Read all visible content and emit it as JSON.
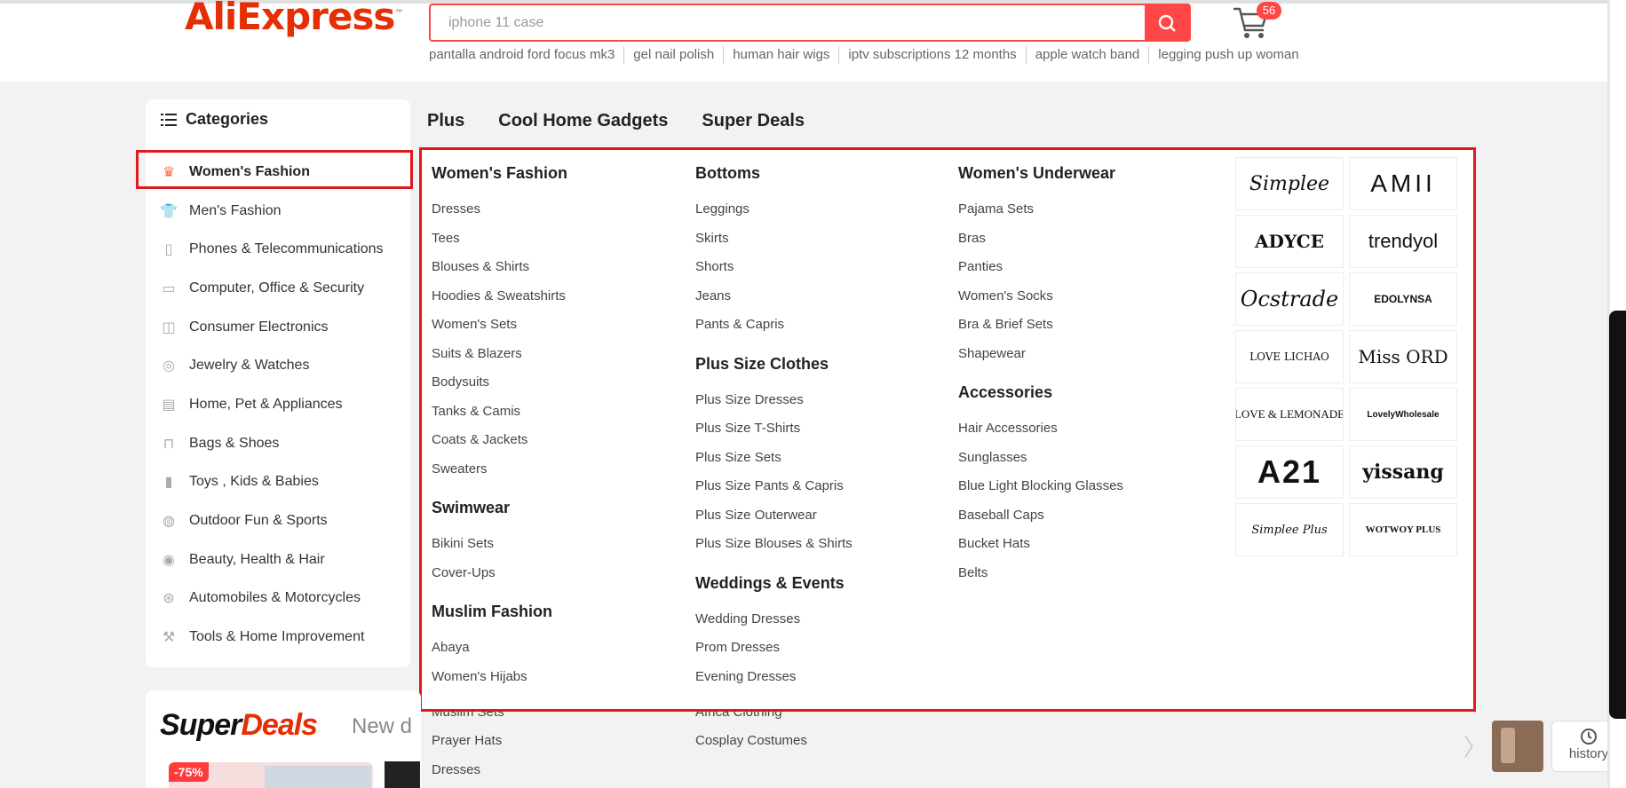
{
  "header": {
    "logo": "AliExpress",
    "search_placeholder": "iphone 11 case",
    "cart_count": "56",
    "hot_searches": [
      "pantalla android ford focus mk3",
      "gel nail polish",
      "human hair wigs",
      "iptv subscriptions 12 months",
      "apple watch band",
      "legging push up woman"
    ]
  },
  "sidebar": {
    "title": "Categories",
    "items": [
      {
        "label": "Women's Fashion",
        "icon": "dress-icon"
      },
      {
        "label": "Men's Fashion",
        "icon": "shirt-icon"
      },
      {
        "label": "Phones & Telecommunications",
        "icon": "phone-icon"
      },
      {
        "label": "Computer, Office & Security",
        "icon": "laptop-icon"
      },
      {
        "label": "Consumer Electronics",
        "icon": "camera-icon"
      },
      {
        "label": "Jewelry & Watches",
        "icon": "ring-icon"
      },
      {
        "label": "Home, Pet & Appliances",
        "icon": "sofa-icon"
      },
      {
        "label": "Bags & Shoes",
        "icon": "bag-icon"
      },
      {
        "label": "Toys , Kids & Babies",
        "icon": "bottle-icon"
      },
      {
        "label": "Outdoor Fun & Sports",
        "icon": "ball-icon"
      },
      {
        "label": "Beauty, Health & Hair",
        "icon": "mirror-icon"
      },
      {
        "label": "Automobiles & Motorcycles",
        "icon": "wheel-icon"
      },
      {
        "label": "Tools & Home Improvement",
        "icon": "tool-icon"
      }
    ]
  },
  "nav": [
    "Plus",
    "Cool Home Gadgets",
    "Super Deals"
  ],
  "menu": {
    "col1": [
      {
        "title": "Women's Fashion",
        "items": [
          "Dresses",
          "Tees",
          "Blouses & Shirts",
          "Hoodies & Sweatshirts",
          "Women's Sets",
          "Suits & Blazers",
          "Bodysuits",
          "Tanks & Camis",
          "Coats & Jackets",
          "Sweaters"
        ]
      },
      {
        "title": "Swimwear",
        "items": [
          "Bikini Sets",
          "Cover-Ups"
        ]
      },
      {
        "title": "Muslim Fashion",
        "items": [
          "Abaya",
          "Women's Hijabs"
        ]
      }
    ],
    "col2": [
      {
        "title": "Bottoms",
        "items": [
          "Leggings",
          "Skirts",
          "Shorts",
          "Jeans",
          "Pants & Capris"
        ]
      },
      {
        "title": "Plus Size Clothes",
        "items": [
          "Plus Size Dresses",
          "Plus Size T-Shirts",
          "Plus Size Sets",
          "Plus Size Pants & Capris",
          "Plus Size Outerwear",
          "Plus Size Blouses & Shirts"
        ]
      },
      {
        "title": "Weddings & Events",
        "items": [
          "Wedding Dresses",
          "Prom Dresses",
          "Evening Dresses"
        ]
      }
    ],
    "col3": [
      {
        "title": "Women's Underwear",
        "items": [
          "Pajama Sets",
          "Bras",
          "Panties",
          "Women's Socks",
          "Bra & Brief Sets",
          "Shapewear"
        ]
      },
      {
        "title": "Accessories",
        "items": [
          "Hair Accessories",
          "Sunglasses",
          "Blue Light Blocking Glasses",
          "Baseball Caps",
          "Bucket Hats",
          "Belts"
        ]
      }
    ],
    "brands": [
      "Simplee",
      "AMII",
      "ADYCE",
      "trendyol",
      "Ocstrade",
      "EDOLYNSA",
      "LOVE LICHAO",
      "Miss ORD",
      "LOVE & LEMONADE",
      "LovelyWholesale",
      "A21",
      "yissang",
      "Simplee Plus",
      "WOTWOY PLUS"
    ]
  },
  "overflow": {
    "col1": [
      "Muslim Sets",
      "Prayer Hats",
      "Dresses"
    ],
    "col2": [
      "Africa Clothing",
      "Cosplay Costumes"
    ]
  },
  "superdeals": {
    "title_a": "Super",
    "title_b": "Deals",
    "subtitle": "New d",
    "badge": "-75%"
  },
  "history": {
    "label": "history"
  },
  "colors": {
    "accent": "#ff4747",
    "highlight": "#e0191f",
    "brand": "#e62e04"
  }
}
